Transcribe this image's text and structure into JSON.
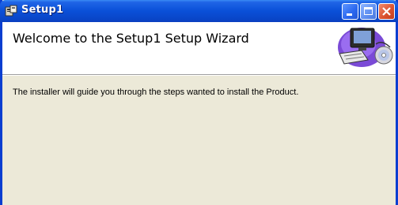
{
  "window": {
    "title": "Setup1",
    "icon": "setup-installer-icon",
    "controls": [
      "minimize-icon",
      "maximize-icon",
      "close-icon"
    ]
  },
  "header": {
    "title": "Welcome to the Setup1 Setup Wizard",
    "art": "computer-with-cd-icon"
  },
  "main": {
    "message": "The installer will guide you through the steps wanted to install the Product."
  },
  "colors": {
    "titlebar": "#0a50d8",
    "panel": "#ece9d8",
    "header_bg": "#ffffff",
    "close_button": "#d9502e"
  }
}
